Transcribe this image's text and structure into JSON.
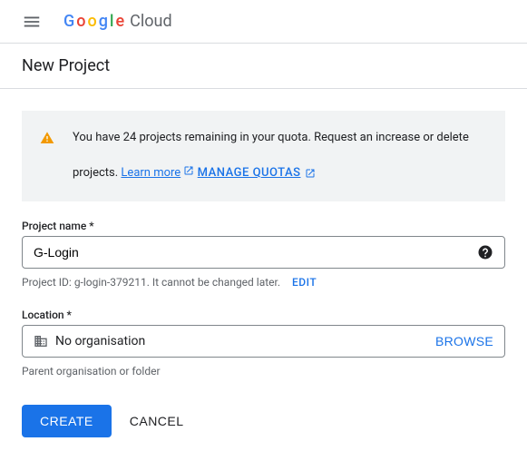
{
  "header": {
    "logo_text": "Google",
    "logo_suffix": "Cloud"
  },
  "page": {
    "title": "New Project"
  },
  "notice": {
    "message": "You have 24 projects remaining in your quota. Request an increase or delete projects. ",
    "learn_more": "Learn more",
    "manage_quotas": "MANAGE QUOTAS"
  },
  "project_name": {
    "label": "Project name *",
    "value": "G-Login",
    "hint_prefix": "Project ID: ",
    "project_id": "g-login-379211",
    "hint_suffix": ". It cannot be changed later.",
    "edit": "EDIT"
  },
  "location": {
    "label": "Location *",
    "value": "No organisation",
    "browse": "BROWSE",
    "hint": "Parent organisation or folder"
  },
  "actions": {
    "create": "CREATE",
    "cancel": "CANCEL"
  }
}
